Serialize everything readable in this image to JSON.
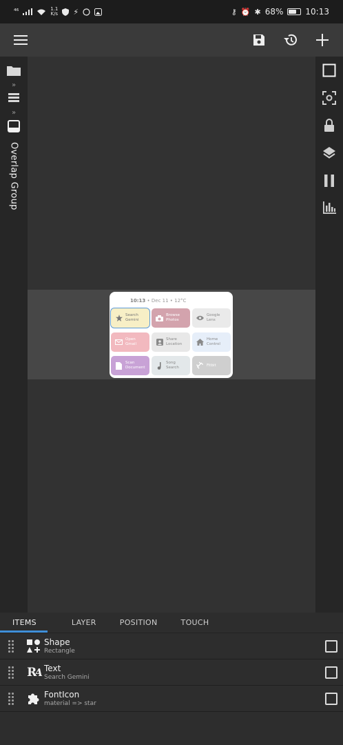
{
  "status_bar": {
    "network_signal": "⁴⁶",
    "net_speed_value": "1.1",
    "net_speed_unit": "K/s",
    "battery_percent": "68%",
    "battery_level": 0.68,
    "time": "10:13"
  },
  "toolbar": {
    "menu_icon": "menu-icon",
    "save_icon": "save-icon",
    "history_icon": "history-icon",
    "add_icon": "add-icon"
  },
  "left_rail": {
    "label": "Overlap Group"
  },
  "widget_preview": {
    "header_time": "10:13",
    "header_rest": " • Dec 11 • 12°C",
    "tiles": [
      {
        "label": "Search\nGemini",
        "icon": "star-icon",
        "bg": "#f7efc6"
      },
      {
        "label": "Browse\nPhotos",
        "icon": "camera-icon",
        "bg": "#d3a3ad"
      },
      {
        "label": "Google\nLens",
        "icon": "eye-icon",
        "bg": "#eaeaea"
      },
      {
        "label": "Open\nGmail",
        "icon": "mail-icon",
        "bg": "#f2b9bf"
      },
      {
        "label": "Share\nLocation",
        "icon": "contact-icon",
        "bg": "#e8e8e8"
      },
      {
        "label": "Home\nControl",
        "icon": "home-icon",
        "bg": "#e6eef9"
      },
      {
        "label": "Scan\nDocument",
        "icon": "document-icon",
        "bg": "#c8a2d6"
      },
      {
        "label": "Song\nSearch",
        "icon": "music-note-icon",
        "bg": "#e3e8ea"
      },
      {
        "label": "Fitbit",
        "icon": "fitness-icon",
        "bg": "#cfcfcf"
      }
    ]
  },
  "tabs": [
    "ITEMS",
    "LAYER",
    "POSITION",
    "TOUCH"
  ],
  "items": [
    {
      "title": "Shape",
      "subtitle": "Rectangle",
      "icon": "shapes-icon"
    },
    {
      "title": "Text",
      "subtitle": "Search Gemini",
      "icon": "text-format-icon"
    },
    {
      "title": "FontIcon",
      "subtitle": "material => star",
      "icon": "puzzle-icon"
    }
  ]
}
